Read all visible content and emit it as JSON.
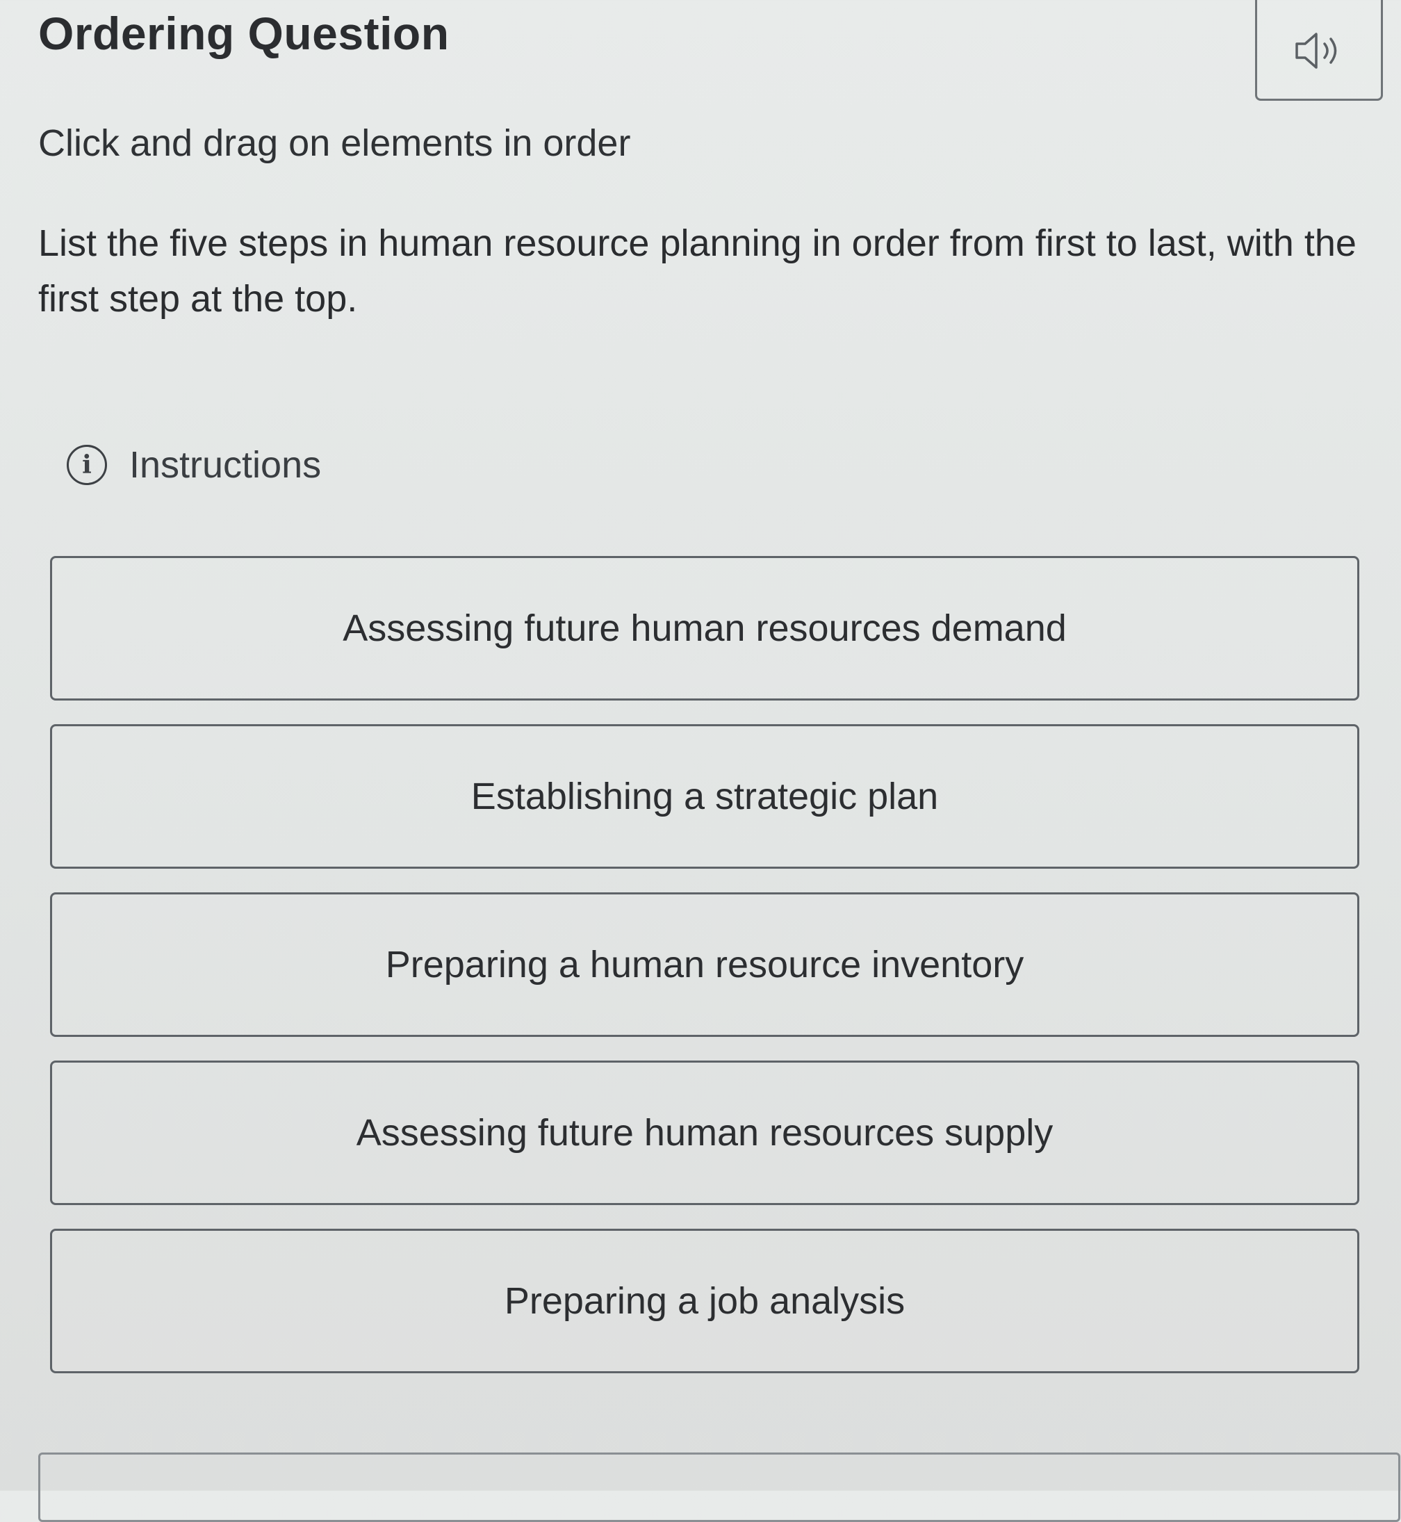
{
  "header": {
    "title": "Ordering Question",
    "audio_icon": "speaker-icon"
  },
  "prompt": {
    "directive": "Click and drag on elements in order",
    "question": "List the five steps in human resource planning in order from first to last, with the first step at the top."
  },
  "instructions": {
    "icon": "info-icon",
    "icon_glyph": "i",
    "label": "Instructions"
  },
  "items": [
    {
      "label": "Assessing future human resources demand"
    },
    {
      "label": "Establishing a strategic plan"
    },
    {
      "label": "Preparing a human resource inventory"
    },
    {
      "label": "Assessing future human resources supply"
    },
    {
      "label": "Preparing a job analysis"
    }
  ],
  "colors": {
    "border": "#5e6368",
    "text": "#2a2c2e",
    "background": "#e4e7e6"
  }
}
